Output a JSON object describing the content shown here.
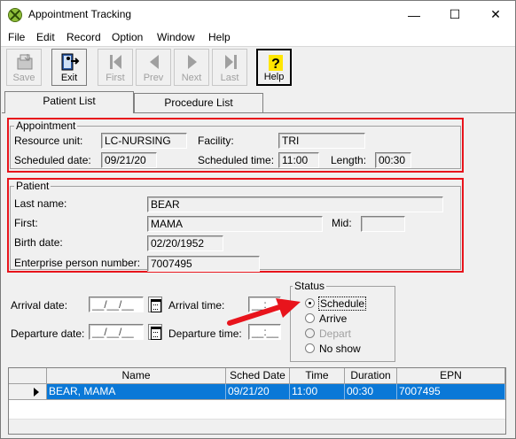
{
  "window": {
    "title": "Appointment Tracking",
    "min_glyph": "—",
    "max_glyph": "☐",
    "close_glyph": "✕"
  },
  "menu": [
    "File",
    "Edit",
    "Record",
    "Option",
    "Window",
    "Help"
  ],
  "toolbar": {
    "save": "Save",
    "exit": "Exit",
    "first": "First",
    "prev": "Prev",
    "next": "Next",
    "last": "Last",
    "help": "Help"
  },
  "tabs": {
    "patient_list": "Patient List",
    "procedure_list": "Procedure  List"
  },
  "appointment": {
    "group_label": "Appointment",
    "resource_unit_label": "Resource unit:",
    "resource_unit": "LC-NURSING",
    "facility_label": "Facility:",
    "facility": "TRI",
    "scheduled_date_label": "Scheduled date:",
    "scheduled_date": "09/21/20",
    "scheduled_time_label": "Scheduled time:",
    "scheduled_time": "11:00",
    "length_label": "Length:",
    "length": "00:30"
  },
  "patient": {
    "group_label": "Patient",
    "last_name_label": "Last name:",
    "last_name": "BEAR",
    "first_label": "First:",
    "first": "MAMA",
    "mid_label": "Mid:",
    "mid": "",
    "birth_date_label": "Birth date:",
    "birth_date": "02/20/1952",
    "epn_label": "Enterprise person number:",
    "epn": "7007495"
  },
  "arrival": {
    "arrival_date_label": "Arrival date:",
    "arrival_date": "__/__/__",
    "arrival_time_label": "Arrival time:",
    "arrival_time": "__:__",
    "departure_date_label": "Departure date:",
    "departure_date": "__/__/__",
    "departure_time_label": "Departure time:",
    "departure_time": "__:__"
  },
  "status": {
    "group_label": "Status",
    "options": [
      "Schedule",
      "Arrive",
      "Depart",
      "No show"
    ],
    "selected": "Schedule"
  },
  "grid": {
    "columns": [
      "Name",
      "Sched Date",
      "Time",
      "Duration",
      "EPN"
    ],
    "rows": [
      {
        "name": "BEAR, MAMA",
        "sched_date": "09/21/20",
        "time": "11:00",
        "duration": "00:30",
        "epn": "7007495"
      }
    ]
  },
  "colors": {
    "highlight": "#e8141c",
    "selection": "#0a78d7"
  }
}
